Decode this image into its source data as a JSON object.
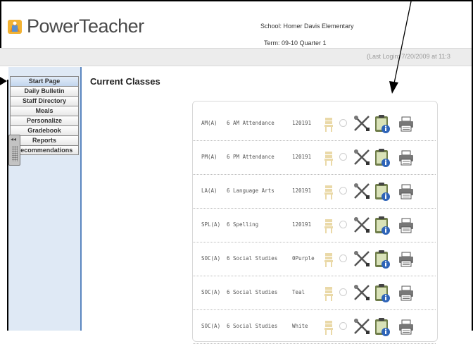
{
  "app": {
    "name": "PowerTeacher"
  },
  "header": {
    "school": "School:  Homer Davis Elementary",
    "term": "Term:  09-10 Quarter 1",
    "last_login": "(Last Login: 7/20/2009 at 11:3"
  },
  "sidebar": {
    "items": [
      {
        "label": "Start Page"
      },
      {
        "label": "Daily Bulletin"
      },
      {
        "label": "Staff Directory"
      },
      {
        "label": "Meals"
      },
      {
        "label": "Personalize"
      },
      {
        "label": "Gradebook"
      },
      {
        "label": "Reports"
      },
      {
        "label": "Recommendations"
      }
    ],
    "collapse_glyph": "◂◂"
  },
  "main": {
    "title": "Current Classes",
    "classes": [
      {
        "code": "AM(A)",
        "name": "6 AM Attendance",
        "period": "120191"
      },
      {
        "code": "PM(A)",
        "name": "6 PM Attendance",
        "period": "120191"
      },
      {
        "code": "LA(A)",
        "name": "6 Language Arts",
        "period": "120191"
      },
      {
        "code": "SPL(A)",
        "name": "6 Spelling",
        "period": "120191"
      },
      {
        "code": "SOC(A)",
        "name": "6 Social Studies",
        "period": "0Purple"
      },
      {
        "code": "SOC(A)",
        "name": "6 Social Studies",
        "period": "Teal"
      },
      {
        "code": "SOC(A)",
        "name": "6 Social Studies",
        "period": "White"
      }
    ]
  },
  "colors": {
    "accent": "#5a86c0",
    "sidebar_bg": "#dfe9f5"
  }
}
